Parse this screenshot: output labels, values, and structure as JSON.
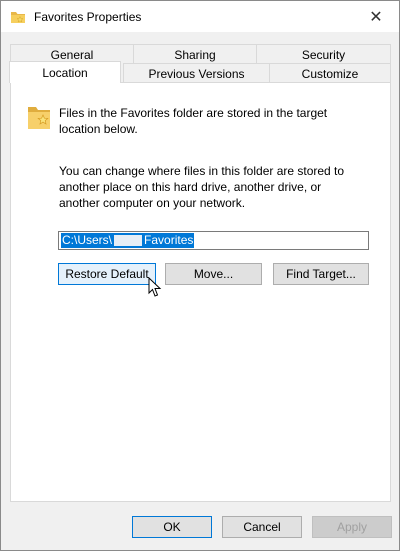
{
  "window": {
    "title": "Favorites Properties",
    "close_glyph": "✕"
  },
  "tabs_row1": [
    {
      "label": "General"
    },
    {
      "label": "Sharing"
    },
    {
      "label": "Security"
    }
  ],
  "tabs_row2": [
    {
      "label": "Location",
      "active": true
    },
    {
      "label": "Previous Versions"
    },
    {
      "label": "Customize"
    }
  ],
  "location": {
    "description1": "Files in the Favorites folder are stored in the target location below.",
    "description2": "You can change where files in this folder are stored to another place on this hard drive, another drive, or another computer on your network.",
    "path_prefix": "C:\\Users\\",
    "path_suffix": "Favorites",
    "restore_default_label": "Restore Default",
    "move_label": "Move...",
    "find_target_label": "Find Target..."
  },
  "footer": {
    "ok_label": "OK",
    "cancel_label": "Cancel",
    "apply_label": "Apply"
  },
  "icons": [
    "folder-favorites-icon",
    "close-icon",
    "mouse-cursor-icon"
  ],
  "colors": {
    "selection": "#0078d7",
    "focus_border": "#0078d7",
    "window_bg": "#f0f0f0"
  }
}
